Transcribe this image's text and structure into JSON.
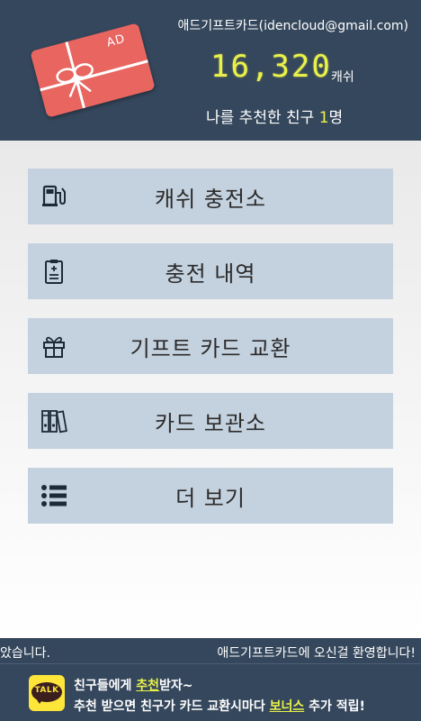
{
  "header": {
    "card_badge": "AD",
    "account_label": "애드기프트카드(idencloud@gmail.com)",
    "balance": "16,320",
    "balance_unit": "캐쉬",
    "referral_prefix": "나를 추천한 친구 ",
    "referral_count": "1",
    "referral_suffix": "명",
    "highlight_color": "#eaf24a",
    "header_bg": "#35475c"
  },
  "menu": {
    "items": [
      {
        "label": "캐쉬 충전소",
        "icon": "gas-pump-icon"
      },
      {
        "label": "충전 내역",
        "icon": "clipboard-icon"
      },
      {
        "label": "기프트 카드 교환",
        "icon": "gift-icon"
      },
      {
        "label": "카드 보관소",
        "icon": "binders-icon"
      },
      {
        "label": "더 보기",
        "icon": "list-icon"
      }
    ],
    "button_bg": "#c4d1de"
  },
  "marquee": {
    "left_text": "았습니다.",
    "right_text": "애드기프트카드에 오신걸 환영합니다!"
  },
  "promo": {
    "icon_text": "TALK",
    "line1_a": "친구들에게 ",
    "line1_hl": "추천",
    "line1_b": "받자~",
    "line2_a": "추천 받으면 친구가 카드 교환시마다 ",
    "line2_hl": "보너스",
    "line2_b": " 추가 적립!"
  }
}
